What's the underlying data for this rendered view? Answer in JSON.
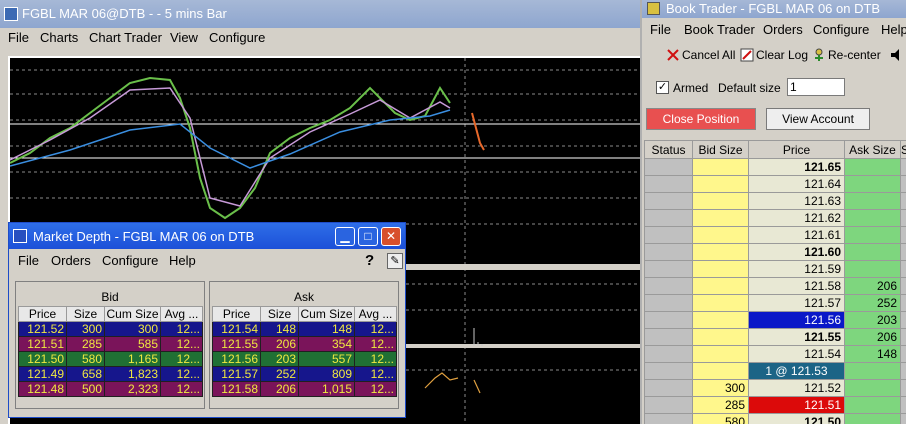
{
  "chart_window": {
    "title": "FGBL MAR 06@DTB -   - 5 mins Bar",
    "menu": [
      "File",
      "Charts",
      "Chart Trader",
      "View",
      "Configure"
    ]
  },
  "book_trader": {
    "title": "Book Trader - FGBL MAR 06 on DTB",
    "menu": [
      "File",
      "Book Trader",
      "Orders",
      "Configure",
      "Help"
    ],
    "tools": [
      "Cancel All",
      "Clear Log",
      "Re-center"
    ],
    "armed_label": "Armed",
    "armed_checked": "✓",
    "default_size_label": "Default size",
    "default_size_value": "1",
    "close_position": "Close Position",
    "view_account": "View Account",
    "headers": [
      "Status",
      "Bid Size",
      "Price",
      "Ask Size",
      "S"
    ],
    "rows": [
      {
        "bid": "",
        "price": "121.65",
        "ask": ""
      },
      {
        "bid": "",
        "price": "121.64",
        "ask": ""
      },
      {
        "bid": "",
        "price": "121.63",
        "ask": ""
      },
      {
        "bid": "",
        "price": "121.62",
        "ask": ""
      },
      {
        "bid": "",
        "price": "121.61",
        "ask": ""
      },
      {
        "bid": "",
        "price": "121.60",
        "ask": ""
      },
      {
        "bid": "",
        "price": "121.59",
        "ask": ""
      },
      {
        "bid": "",
        "price": "121.58",
        "ask": "206"
      },
      {
        "bid": "",
        "price": "121.57",
        "ask": "252"
      },
      {
        "bid": "",
        "price": "121.56",
        "ask": "203"
      },
      {
        "bid": "",
        "price": "121.55",
        "ask": "206"
      },
      {
        "bid": "",
        "price": "121.54",
        "ask": "148"
      },
      {
        "bid": "",
        "price": "1 @ 121.53",
        "ask": ""
      },
      {
        "bid": "300",
        "price": "121.52",
        "ask": ""
      },
      {
        "bid": "285",
        "price": "121.51",
        "ask": ""
      },
      {
        "bid": "580",
        "price": "121.50",
        "ask": ""
      }
    ]
  },
  "market_depth": {
    "title": "Market Depth - FGBL MAR 06 on DTB",
    "menu": [
      "File",
      "Orders",
      "Configure",
      "Help"
    ],
    "help_glyph": "?",
    "bid_label": "Bid",
    "ask_label": "Ask",
    "headers": [
      "Price",
      "Size",
      "Cum Size",
      "Avg ..."
    ],
    "bid_rows": [
      [
        "121.52",
        "300",
        "300",
        "12..."
      ],
      [
        "121.51",
        "285",
        "585",
        "12..."
      ],
      [
        "121.50",
        "580",
        "1,165",
        "12..."
      ],
      [
        "121.49",
        "658",
        "1,823",
        "12..."
      ],
      [
        "121.48",
        "500",
        "2,323",
        "12..."
      ]
    ],
    "ask_rows": [
      [
        "121.54",
        "148",
        "148",
        "12..."
      ],
      [
        "121.55",
        "206",
        "354",
        "12..."
      ],
      [
        "121.56",
        "203",
        "557",
        "12..."
      ],
      [
        "121.57",
        "252",
        "809",
        "12..."
      ],
      [
        "121.58",
        "206",
        "1,015",
        "12..."
      ]
    ]
  },
  "colors": {
    "bid_size_bg": "#fff78c",
    "ask_size_bg": "#7ed67e",
    "close_position_bg": "#e85050",
    "price_highlight_blue": "#0a18c8",
    "price_highlight_red": "#dc0a0a",
    "last_trade_bg": "#1c6486"
  }
}
